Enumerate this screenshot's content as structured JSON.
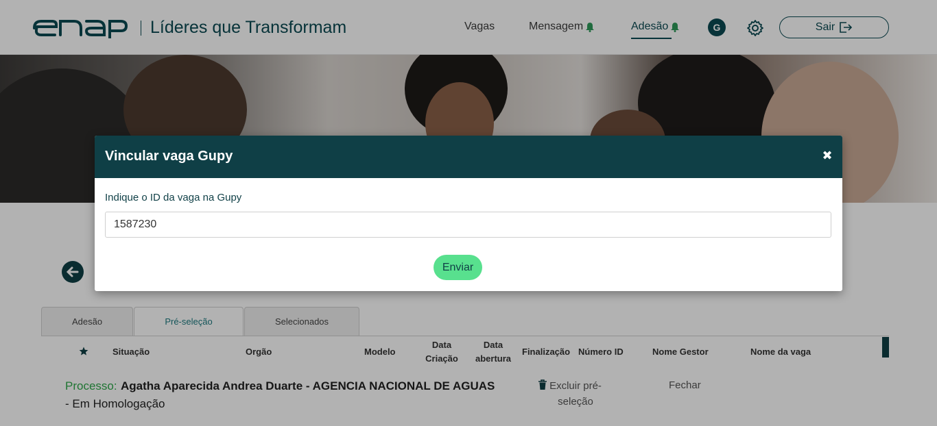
{
  "header": {
    "logo_text": "enap",
    "brand_title": "Líderes que Transformam",
    "nav": [
      {
        "label": "Vagas"
      },
      {
        "label": "Mensagem"
      },
      {
        "label": "Adesão"
      }
    ],
    "avatar_initial": "G",
    "logout_label": "Sair"
  },
  "page": {
    "tabs": [
      {
        "label": "Adesão"
      },
      {
        "label": "Pré-seleção"
      },
      {
        "label": "Selecionados"
      }
    ],
    "table_headers": [
      "Situação",
      "Orgão",
      "Modelo",
      "Data Criação",
      "Data abertura",
      "Finalização",
      "Número ID",
      "Nome Gestor",
      "Nome da vaga"
    ],
    "row": {
      "process_label": "Processo:",
      "process_text": "Agatha Aparecida Andrea Duarte - AGENCIA NACIONAL DE AGUAS",
      "status": "- Em Homologação",
      "delete_label": "Excluir pré-seleção",
      "close_label": "Fechar"
    }
  },
  "modal": {
    "title": "Vincular vaga Gupy",
    "field_label": "Indique o ID da vaga na Gupy",
    "field_value": "1587230",
    "submit_label": "Enviar"
  },
  "colors": {
    "primary": "#0f3f46",
    "accent_green": "#58e08e",
    "process_green": "#2ea84a"
  }
}
